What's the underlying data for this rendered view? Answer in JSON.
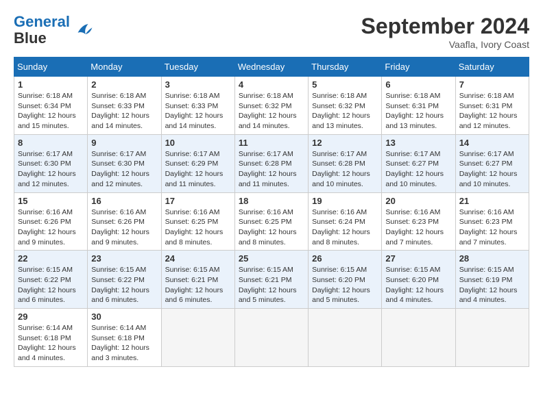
{
  "header": {
    "logo_line1": "General",
    "logo_line2": "Blue",
    "month": "September 2024",
    "location": "Vaafla, Ivory Coast"
  },
  "weekdays": [
    "Sunday",
    "Monday",
    "Tuesday",
    "Wednesday",
    "Thursday",
    "Friday",
    "Saturday"
  ],
  "weeks": [
    [
      {
        "day": 1,
        "sunrise": "6:18 AM",
        "sunset": "6:34 PM",
        "daylight": "12 hours and 15 minutes."
      },
      {
        "day": 2,
        "sunrise": "6:18 AM",
        "sunset": "6:33 PM",
        "daylight": "12 hours and 14 minutes."
      },
      {
        "day": 3,
        "sunrise": "6:18 AM",
        "sunset": "6:33 PM",
        "daylight": "12 hours and 14 minutes."
      },
      {
        "day": 4,
        "sunrise": "6:18 AM",
        "sunset": "6:32 PM",
        "daylight": "12 hours and 14 minutes."
      },
      {
        "day": 5,
        "sunrise": "6:18 AM",
        "sunset": "6:32 PM",
        "daylight": "12 hours and 13 minutes."
      },
      {
        "day": 6,
        "sunrise": "6:18 AM",
        "sunset": "6:31 PM",
        "daylight": "12 hours and 13 minutes."
      },
      {
        "day": 7,
        "sunrise": "6:18 AM",
        "sunset": "6:31 PM",
        "daylight": "12 hours and 12 minutes."
      }
    ],
    [
      {
        "day": 8,
        "sunrise": "6:17 AM",
        "sunset": "6:30 PM",
        "daylight": "12 hours and 12 minutes."
      },
      {
        "day": 9,
        "sunrise": "6:17 AM",
        "sunset": "6:30 PM",
        "daylight": "12 hours and 12 minutes."
      },
      {
        "day": 10,
        "sunrise": "6:17 AM",
        "sunset": "6:29 PM",
        "daylight": "12 hours and 11 minutes."
      },
      {
        "day": 11,
        "sunrise": "6:17 AM",
        "sunset": "6:28 PM",
        "daylight": "12 hours and 11 minutes."
      },
      {
        "day": 12,
        "sunrise": "6:17 AM",
        "sunset": "6:28 PM",
        "daylight": "12 hours and 10 minutes."
      },
      {
        "day": 13,
        "sunrise": "6:17 AM",
        "sunset": "6:27 PM",
        "daylight": "12 hours and 10 minutes."
      },
      {
        "day": 14,
        "sunrise": "6:17 AM",
        "sunset": "6:27 PM",
        "daylight": "12 hours and 10 minutes."
      }
    ],
    [
      {
        "day": 15,
        "sunrise": "6:16 AM",
        "sunset": "6:26 PM",
        "daylight": "12 hours and 9 minutes."
      },
      {
        "day": 16,
        "sunrise": "6:16 AM",
        "sunset": "6:26 PM",
        "daylight": "12 hours and 9 minutes."
      },
      {
        "day": 17,
        "sunrise": "6:16 AM",
        "sunset": "6:25 PM",
        "daylight": "12 hours and 8 minutes."
      },
      {
        "day": 18,
        "sunrise": "6:16 AM",
        "sunset": "6:25 PM",
        "daylight": "12 hours and 8 minutes."
      },
      {
        "day": 19,
        "sunrise": "6:16 AM",
        "sunset": "6:24 PM",
        "daylight": "12 hours and 8 minutes."
      },
      {
        "day": 20,
        "sunrise": "6:16 AM",
        "sunset": "6:23 PM",
        "daylight": "12 hours and 7 minutes."
      },
      {
        "day": 21,
        "sunrise": "6:16 AM",
        "sunset": "6:23 PM",
        "daylight": "12 hours and 7 minutes."
      }
    ],
    [
      {
        "day": 22,
        "sunrise": "6:15 AM",
        "sunset": "6:22 PM",
        "daylight": "12 hours and 6 minutes."
      },
      {
        "day": 23,
        "sunrise": "6:15 AM",
        "sunset": "6:22 PM",
        "daylight": "12 hours and 6 minutes."
      },
      {
        "day": 24,
        "sunrise": "6:15 AM",
        "sunset": "6:21 PM",
        "daylight": "12 hours and 6 minutes."
      },
      {
        "day": 25,
        "sunrise": "6:15 AM",
        "sunset": "6:21 PM",
        "daylight": "12 hours and 5 minutes."
      },
      {
        "day": 26,
        "sunrise": "6:15 AM",
        "sunset": "6:20 PM",
        "daylight": "12 hours and 5 minutes."
      },
      {
        "day": 27,
        "sunrise": "6:15 AM",
        "sunset": "6:20 PM",
        "daylight": "12 hours and 4 minutes."
      },
      {
        "day": 28,
        "sunrise": "6:15 AM",
        "sunset": "6:19 PM",
        "daylight": "12 hours and 4 minutes."
      }
    ],
    [
      {
        "day": 29,
        "sunrise": "6:14 AM",
        "sunset": "6:18 PM",
        "daylight": "12 hours and 4 minutes."
      },
      {
        "day": 30,
        "sunrise": "6:14 AM",
        "sunset": "6:18 PM",
        "daylight": "12 hours and 3 minutes."
      },
      null,
      null,
      null,
      null,
      null
    ]
  ]
}
